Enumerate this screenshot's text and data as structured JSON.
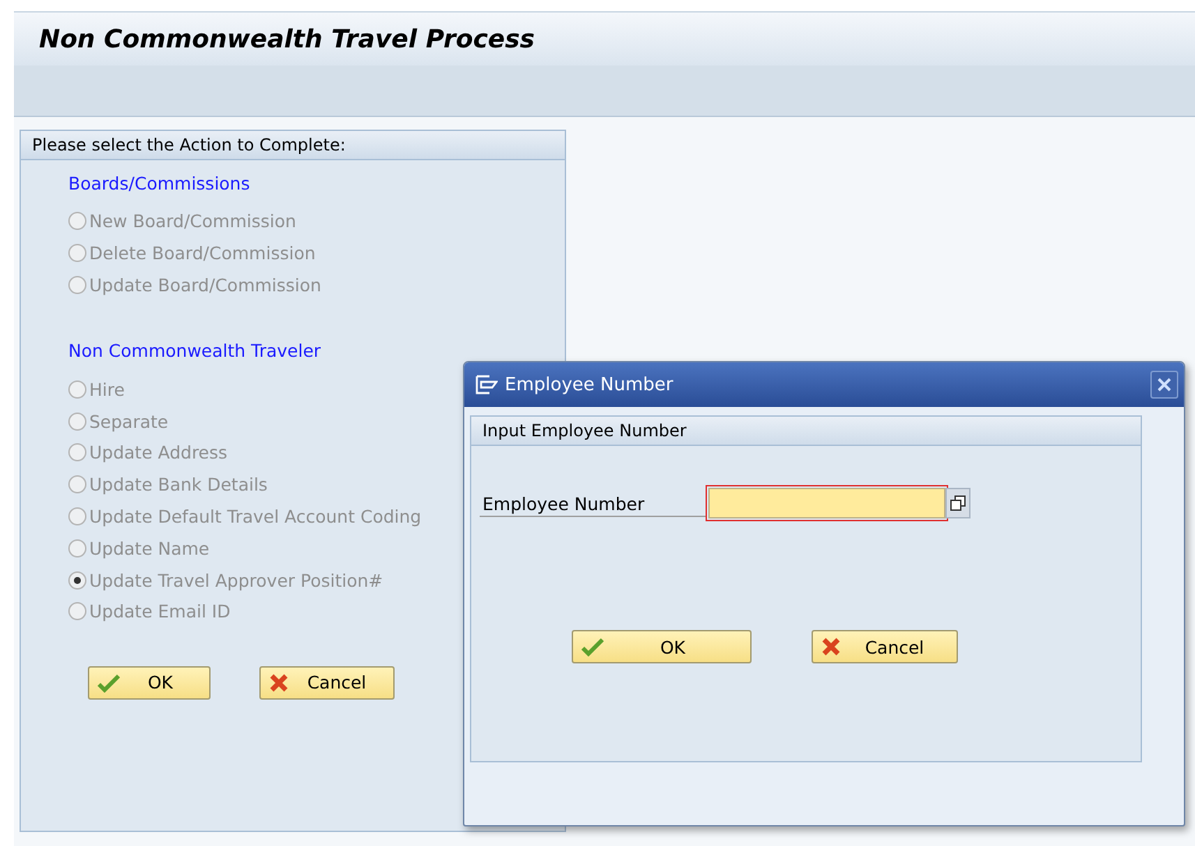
{
  "window": {
    "title": "Non Commonwealth Travel Process"
  },
  "panel": {
    "title": "Please select the Action to Complete:",
    "groups": [
      {
        "heading": "Boards/Commissions",
        "options": [
          {
            "label": "New Board/Commission",
            "selected": false,
            "disabled": true
          },
          {
            "label": "Delete Board/Commission",
            "selected": false,
            "disabled": true
          },
          {
            "label": "Update Board/Commission",
            "selected": false,
            "disabled": true
          }
        ]
      },
      {
        "heading": "Non Commonwealth Traveler",
        "options": [
          {
            "label": "Hire",
            "selected": false,
            "disabled": true
          },
          {
            "label": "Separate",
            "selected": false,
            "disabled": true
          },
          {
            "label": "Update Address",
            "selected": false,
            "disabled": true
          },
          {
            "label": "Update Bank Details",
            "selected": false,
            "disabled": true
          },
          {
            "label": "Update Default Travel Account Coding",
            "selected": false,
            "disabled": true
          },
          {
            "label": "Update Name",
            "selected": false,
            "disabled": true
          },
          {
            "label": "Update Travel Approver Position#",
            "selected": true,
            "disabled": true
          },
          {
            "label": "Update Email ID",
            "selected": false,
            "disabled": true
          }
        ]
      }
    ],
    "buttons": [
      {
        "kind": "ok",
        "label": "OK"
      },
      {
        "kind": "cancel",
        "label": "Cancel"
      }
    ]
  },
  "dialog": {
    "title": "Employee Number",
    "group_title": "Input Employee Number",
    "field_label": "Employee Number",
    "buttons": [
      {
        "kind": "ok",
        "label": "OK"
      },
      {
        "kind": "cancel",
        "label": "Cancel"
      }
    ]
  }
}
